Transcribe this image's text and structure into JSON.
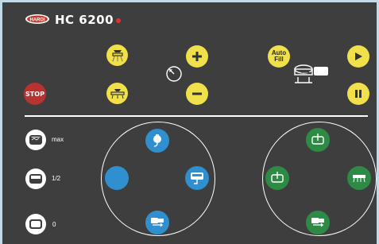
{
  "header": {
    "logo_text": "HARDI",
    "model": "HC 6200",
    "status_color": "#e03030"
  },
  "colors": {
    "panel": "#3e3e3e",
    "yellow": "#f0e04a",
    "stop": "#b83232",
    "blue": "#2f8fcf",
    "green": "#2e8b45"
  },
  "controls": {
    "stop_label": "STOP",
    "auto_fill_line1": "Auto",
    "auto_fill_line2": "Fill"
  },
  "levels": {
    "max_label": "max",
    "half_label": "1/2",
    "zero_label": "0"
  },
  "icons": {
    "plus": "plus-icon",
    "minus": "minus-icon",
    "play": "play-icon",
    "pause": "pause-icon"
  }
}
